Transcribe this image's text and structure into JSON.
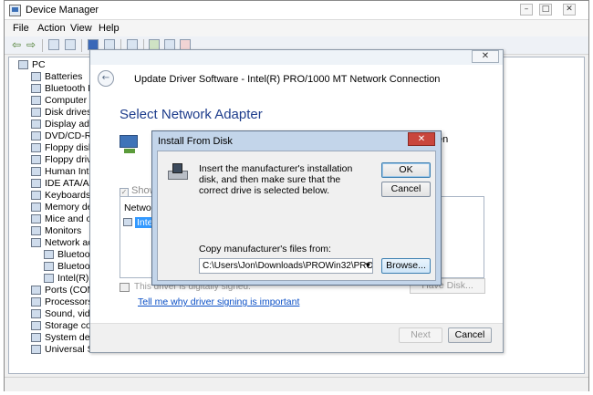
{
  "device_manager": {
    "title": "Device Manager",
    "menus": [
      "File",
      "Action",
      "View",
      "Help"
    ],
    "tree": [
      {
        "label": "PC",
        "level": 0,
        "expander": "expanded"
      },
      {
        "label": "Batteries",
        "level": 1,
        "expander": "collapsed"
      },
      {
        "label": "Bluetooth R",
        "level": 1,
        "expander": "collapsed"
      },
      {
        "label": "Computer",
        "level": 1,
        "expander": "collapsed"
      },
      {
        "label": "Disk drives",
        "level": 1,
        "expander": "collapsed"
      },
      {
        "label": "Display ada",
        "level": 1,
        "expander": "collapsed"
      },
      {
        "label": "DVD/CD-R",
        "level": 1,
        "expander": "collapsed"
      },
      {
        "label": "Floppy disk",
        "level": 1,
        "expander": "collapsed"
      },
      {
        "label": "Floppy driv",
        "level": 1,
        "expander": "collapsed"
      },
      {
        "label": "Human Int",
        "level": 1,
        "expander": "collapsed"
      },
      {
        "label": "IDE ATA/A",
        "level": 1,
        "expander": "collapsed"
      },
      {
        "label": "Keyboards",
        "level": 1,
        "expander": "collapsed"
      },
      {
        "label": "Memory de",
        "level": 1,
        "expander": "collapsed"
      },
      {
        "label": "Mice and o",
        "level": 1,
        "expander": "collapsed"
      },
      {
        "label": "Monitors",
        "level": 1,
        "expander": "collapsed"
      },
      {
        "label": "Network ac",
        "level": 1,
        "expander": "expanded"
      },
      {
        "label": "Bluetoo",
        "level": 2,
        "expander": "none"
      },
      {
        "label": "Bluetoo",
        "level": 2,
        "expander": "none"
      },
      {
        "label": "Intel(R)",
        "level": 2,
        "expander": "none"
      },
      {
        "label": "Ports (COM",
        "level": 1,
        "expander": "collapsed"
      },
      {
        "label": "Processors",
        "level": 1,
        "expander": "collapsed"
      },
      {
        "label": "Sound, vide",
        "level": 1,
        "expander": "collapsed"
      },
      {
        "label": "Storage co",
        "level": 1,
        "expander": "collapsed"
      },
      {
        "label": "System dev",
        "level": 1,
        "expander": "collapsed"
      },
      {
        "label": "Universal S",
        "level": 1,
        "expander": "collapsed"
      }
    ]
  },
  "wizard": {
    "close_label": "✕",
    "back_icon": "back-arrow-icon",
    "title": "Update Driver Software - Intel(R) PRO/1000 MT Network Connection",
    "heading": "Select Network Adapter",
    "trailing_text": "en",
    "show_compatible": "Show",
    "list_header": "Network",
    "list_item": "Intel",
    "signed_text": "This driver is digitally signed.",
    "signing_link": "Tell me why driver signing is important",
    "have_disk": "Have Disk...",
    "next_label": "Next",
    "cancel_label": "Cancel"
  },
  "install_from_disk": {
    "title": "Install From Disk",
    "close_label": "✕",
    "message": "Insert the manufacturer's installation disk, and then make sure that the correct drive is selected below.",
    "ok_label": "OK",
    "cancel_label": "Cancel",
    "copy_label": "Copy manufacturer's files from:",
    "path_value": "C:\\Users\\Jon\\Downloads\\PROWin32\\PRO1000\\",
    "browse_label": "Browse..."
  },
  "colors": {
    "heading_blue": "#1e3d8c",
    "link_blue": "#0a4fc6",
    "selection": "#3399ff",
    "dialog_frame": "#c3d5ea",
    "close_red": "#c9463d"
  }
}
